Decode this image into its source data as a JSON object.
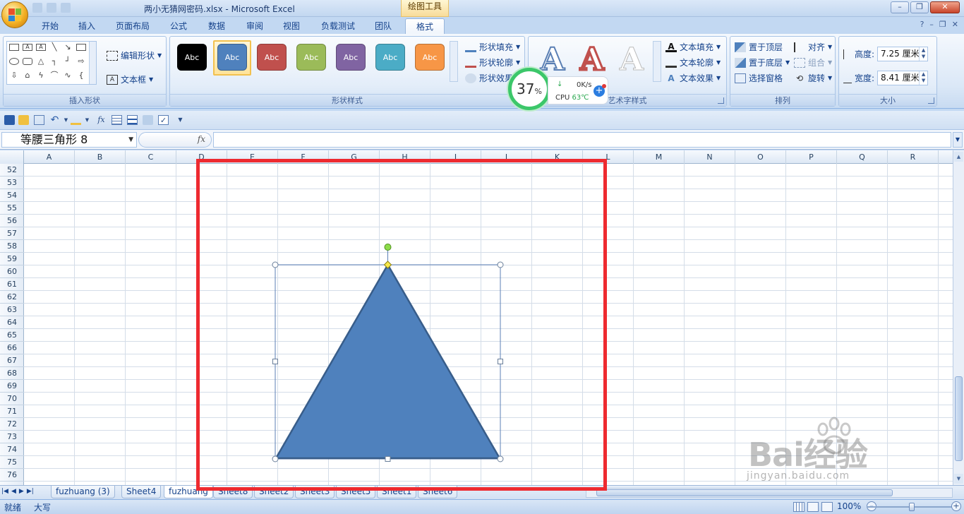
{
  "window": {
    "title": "两小无猜网密码.xlsx - Microsoft Excel",
    "context_tab_group": "绘图工具"
  },
  "tabs": [
    {
      "label": "开始"
    },
    {
      "label": "插入"
    },
    {
      "label": "页面布局"
    },
    {
      "label": "公式"
    },
    {
      "label": "数据"
    },
    {
      "label": "审阅"
    },
    {
      "label": "视图"
    },
    {
      "label": "负载测试"
    },
    {
      "label": "团队"
    },
    {
      "label": "格式",
      "active": true
    }
  ],
  "ribbon": {
    "insert_shapes": {
      "label": "插入形状",
      "edit_shape": "编辑形状",
      "text_box": "文本框"
    },
    "shape_styles": {
      "label": "形状样式",
      "swatch_text": "Abc",
      "swatches": [
        "#000000",
        "#4f81bd",
        "#c0504d",
        "#9bbb59",
        "#8064a2",
        "#4bacc6",
        "#f79646"
      ],
      "fill": "形状填充",
      "outline": "形状轮廓",
      "effects": "形状效果"
    },
    "wordart": {
      "label": "艺术字样式",
      "glyph": "A",
      "text_fill": "文本填充",
      "text_outline": "文本轮廓",
      "text_effects": "文本效果"
    },
    "arrange": {
      "label": "排列",
      "bring_front": "置于顶层",
      "send_back": "置于底层",
      "selection_pane": "选择窗格",
      "align": "对齐",
      "group": "组合",
      "rotate": "旋转"
    },
    "size": {
      "label": "大小",
      "height_label": "高度:",
      "height_value": "7.25 厘米",
      "width_label": "宽度:",
      "width_value": "8.41 厘米"
    }
  },
  "cpu_widget": {
    "percent": "37",
    "percent_sign": "%",
    "net": "0K/s",
    "cpu_label": "CPU",
    "temp": "63℃"
  },
  "formula_bar": {
    "name_box": "等腰三角形 8",
    "fx": "fx",
    "formula": ""
  },
  "columns": [
    "A",
    "B",
    "C",
    "D",
    "E",
    "F",
    "G",
    "H",
    "I",
    "J",
    "K",
    "L",
    "M",
    "N",
    "O",
    "P",
    "Q",
    "R"
  ],
  "rows": [
    "52",
    "53",
    "54",
    "55",
    "56",
    "57",
    "58",
    "59",
    "60",
    "61",
    "62",
    "63",
    "64",
    "65",
    "66",
    "67",
    "68",
    "69",
    "70",
    "71",
    "72",
    "73",
    "74",
    "75",
    "76"
  ],
  "shape": {
    "name": "等腰三角形 8",
    "fill": "#4f81bd",
    "outline": "#385d8a"
  },
  "sheets": [
    {
      "label": "fuzhuang (3)"
    },
    {
      "label": "Sheet4"
    },
    {
      "label": "fuzhuang",
      "active": true
    },
    {
      "label": "Sheet8"
    },
    {
      "label": "Sheet2"
    },
    {
      "label": "Sheet3"
    },
    {
      "label": "Sheet5"
    },
    {
      "label": "Sheet1"
    },
    {
      "label": "Sheet6"
    }
  ],
  "status": {
    "ready": "就绪",
    "caps": "大写",
    "zoom": "100%"
  },
  "watermark": {
    "brand": "Bai经验",
    "url": "jingyan.baidu.com"
  },
  "colors": {
    "highlight": "#ee2a30",
    "accent": "#15428b"
  }
}
